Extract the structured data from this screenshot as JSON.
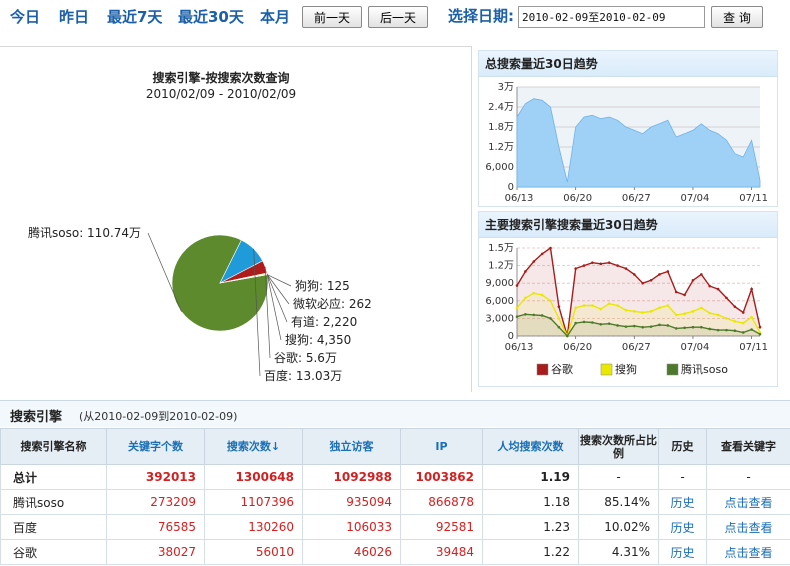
{
  "toolbar": {
    "quick_links": [
      "今日",
      "昨日",
      "最近7天",
      "最近30天",
      "本月"
    ],
    "prev_day": "前一天",
    "next_day": "后一天",
    "date_label": "选择日期:",
    "date_value": "2010-02-09至2010-02-09",
    "query_button": "查 询"
  },
  "pie": {
    "title": "搜索引擎-按搜索次数查询",
    "subtitle": "2010/02/09 - 2010/02/09",
    "slices": [
      {
        "label": "腾讯soso: 110.74万",
        "value": 1107396,
        "color": "#5c8a2c"
      },
      {
        "label": "百度: 13.03万",
        "value": 130260,
        "color": "#1f9bd9"
      },
      {
        "label": "谷歌: 5.6万",
        "value": 56010,
        "color": "#b01c1c"
      },
      {
        "label": "搜狗: 4,350",
        "value": 4350,
        "color": "#e6e600"
      },
      {
        "label": "有道: 2,220",
        "value": 2220,
        "color": "#3a4a8c"
      },
      {
        "label": "微软必应: 262",
        "value": 262,
        "color": "#8c4aa0"
      },
      {
        "label": "狗狗: 125",
        "value": 125,
        "color": "#e07020"
      }
    ]
  },
  "chart_data": [
    {
      "type": "area",
      "title": "总搜索量近30日趋势",
      "y_ticks": [
        "0",
        "6,000",
        "1.2万",
        "1.8万",
        "2.4万",
        "3万"
      ],
      "ylim": [
        0,
        30000
      ],
      "x_ticks": [
        "06/13",
        "06/20",
        "06/27",
        "07/04",
        "07/11"
      ],
      "series": [
        {
          "values": [
            21000,
            25000,
            26500,
            26000,
            24000,
            12000,
            1500,
            18000,
            21000,
            21500,
            20500,
            21000,
            20000,
            18000,
            17000,
            16000,
            18000,
            19000,
            20000,
            15000,
            16000,
            17000,
            19000,
            17000,
            16000,
            14000,
            10000,
            9000,
            14000,
            2000
          ]
        }
      ]
    },
    {
      "type": "line",
      "title": "主要搜索引擎搜索量近30日趋势",
      "y_ticks": [
        "0",
        "3,000",
        "6,000",
        "9,000",
        "1.2万",
        "1.5万"
      ],
      "ylim": [
        0,
        15000
      ],
      "x_ticks": [
        "06/13",
        "06/20",
        "06/27",
        "07/04",
        "07/11"
      ],
      "legend": "bottom",
      "series": [
        {
          "name": "谷歌",
          "color": "#a81c1c",
          "values": [
            8600,
            11000,
            12700,
            14000,
            15000,
            5000,
            0,
            11500,
            12000,
            12500,
            12300,
            12500,
            12000,
            11500,
            10500,
            9000,
            9500,
            10500,
            11000,
            7500,
            7000,
            9500,
            10500,
            8500,
            8000,
            6500,
            5000,
            4000,
            8000,
            1500
          ]
        },
        {
          "name": "搜狗",
          "color": "#e8e800",
          "values": [
            4800,
            6500,
            7300,
            7000,
            6000,
            3000,
            0,
            4800,
            5200,
            5200,
            4600,
            5500,
            5200,
            4400,
            4200,
            4000,
            4200,
            4800,
            5200,
            3600,
            3800,
            4200,
            4800,
            3900,
            3600,
            3000,
            2500,
            2200,
            3200,
            600
          ]
        },
        {
          "name": "腾讯soso",
          "color": "#4d7a2a",
          "values": [
            3300,
            3700,
            3600,
            3500,
            3000,
            1500,
            0,
            2200,
            2400,
            2300,
            2000,
            2100,
            1800,
            1600,
            1700,
            1500,
            1600,
            1900,
            1800,
            1300,
            1400,
            1500,
            1500,
            1200,
            1000,
            1000,
            900,
            600,
            1100,
            300
          ]
        }
      ]
    }
  ],
  "table": {
    "section_title": "搜索引擎",
    "section_range": "(从2010-02-09到2010-02-09)",
    "headers": [
      "搜索引擎名称",
      "关键字个数",
      "搜索次数↓",
      "独立访客",
      "IP",
      "人均搜索次数",
      "搜索次数所占比例",
      "历史",
      "查看关键字"
    ],
    "rows": [
      [
        "总计",
        "392013",
        "1300648",
        "1092988",
        "1003862",
        "1.19",
        "-",
        "-",
        "-"
      ],
      [
        "腾讯soso",
        "273209",
        "1107396",
        "935094",
        "866878",
        "1.18",
        "85.14%",
        "历史",
        "点击查看"
      ],
      [
        "百度",
        "76585",
        "130260",
        "106033",
        "92581",
        "1.23",
        "10.02%",
        "历史",
        "点击查看"
      ],
      [
        "谷歌",
        "38027",
        "56010",
        "46026",
        "39484",
        "1.22",
        "4.31%",
        "历史",
        "点击查看"
      ]
    ]
  }
}
